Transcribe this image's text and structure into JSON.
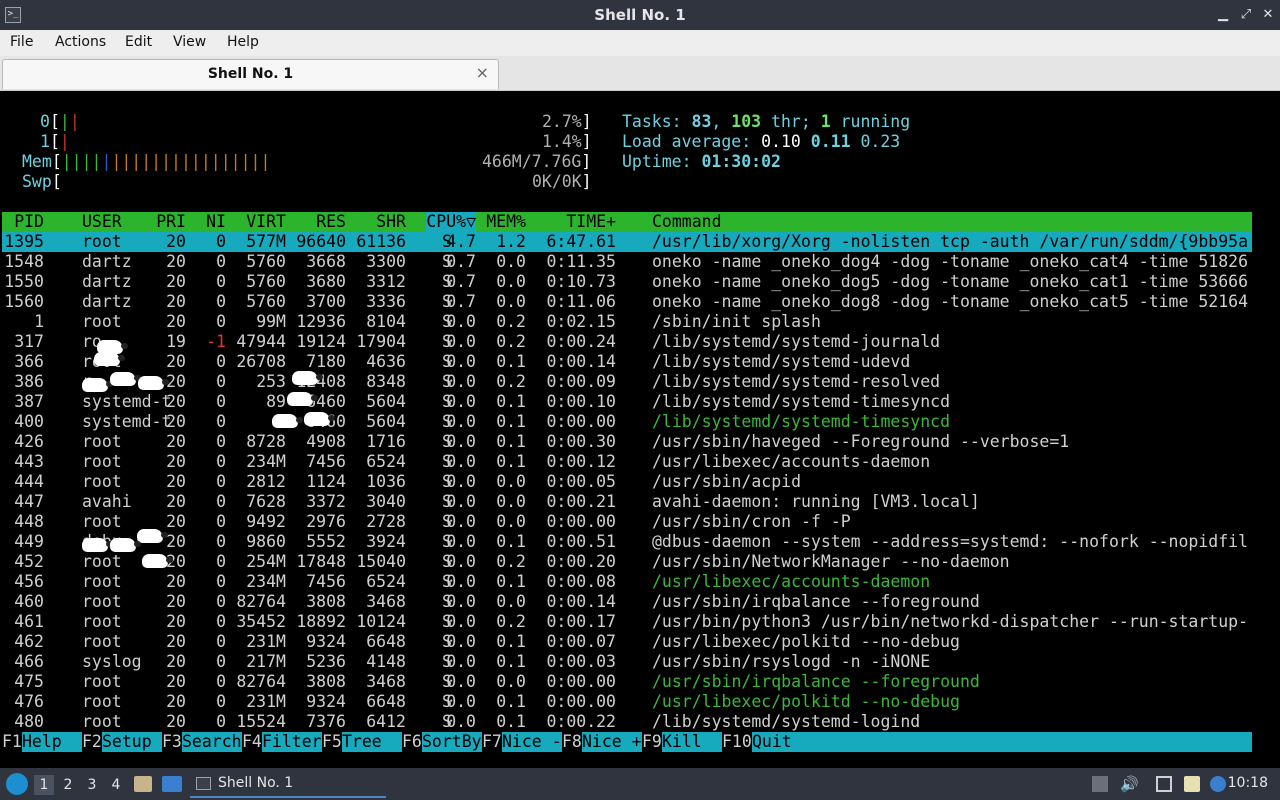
{
  "window": {
    "title": "Shell No. 1"
  },
  "menu": [
    "File",
    "Actions",
    "Edit",
    "View",
    "Help"
  ],
  "tab": {
    "label": "Shell No. 1",
    "close": "×"
  },
  "meters": {
    "cpu0": {
      "label": "0",
      "percent": "2.7%",
      "usage_fraction": 0.027
    },
    "cpu1": {
      "label": "1",
      "percent": "1.4%",
      "usage_fraction": 0.014
    },
    "mem": {
      "label": "Mem",
      "value": "466M/7.76G"
    },
    "swp": {
      "label": "Swp",
      "value": "0K/0K"
    }
  },
  "summary": {
    "tasks_label": "Tasks:",
    "tasks": "83",
    "thr": "103",
    "thr_label": " thr;",
    "running": "1",
    "running_label": "running",
    "load_label": "Load average:",
    "load1": "0.10",
    "load5": "0.11",
    "load15": "0.23",
    "uptime_label": "Uptime:",
    "uptime": "01:30:02"
  },
  "columns": [
    "PID",
    "USER",
    "PRI",
    "NI",
    "VIRT",
    "RES",
    "SHR",
    "S",
    "CPU%▽",
    "MEM%",
    "TIME+",
    "Command"
  ],
  "processes": [
    {
      "pid": "1395",
      "user": "root",
      "pri": "20",
      "ni": "0",
      "virt": "577M",
      "res": "96640",
      "shr": "61136",
      "s": "S",
      "cpu": "4.7",
      "mem": "1.2",
      "time": "6:47.61",
      "cmd": "/usr/lib/xorg/Xorg -nolisten tcp -auth /var/run/sddm/{9bb95a",
      "selected": true
    },
    {
      "pid": "1548",
      "user": "dartz",
      "pri": "20",
      "ni": "0",
      "virt": "5760",
      "res": "3668",
      "shr": "3300",
      "s": "S",
      "cpu": "0.7",
      "mem": "0.0",
      "time": "0:11.35",
      "cmd": "oneko -name _oneko_dog4 -dog -toname _oneko_cat4 -time 51826"
    },
    {
      "pid": "1550",
      "user": "dartz",
      "pri": "20",
      "ni": "0",
      "virt": "5760",
      "res": "3680",
      "shr": "3312",
      "s": "S",
      "cpu": "0.7",
      "mem": "0.0",
      "time": "0:10.73",
      "cmd": "oneko -name _oneko_dog5 -dog -toname _oneko_cat1 -time 53666"
    },
    {
      "pid": "1560",
      "user": "dartz",
      "pri": "20",
      "ni": "0",
      "virt": "5760",
      "res": "3700",
      "shr": "3336",
      "s": "S",
      "cpu": "0.7",
      "mem": "0.0",
      "time": "0:11.06",
      "cmd": "oneko -name _oneko_dog8 -dog -toname _oneko_cat5 -time 52164"
    },
    {
      "pid": "1",
      "user": "root",
      "pri": "20",
      "ni": "0",
      "virt": "99M",
      "res": "12936",
      "shr": "8104",
      "s": "S",
      "cpu": "0.0",
      "mem": "0.2",
      "time": "0:02.15",
      "cmd": "/sbin/init splash"
    },
    {
      "pid": "317",
      "user": "ro",
      "pri": "19",
      "ni": "-1",
      "virt": "47944",
      "res": "19124",
      "shr": "17904",
      "s": "S",
      "cpu": "0.0",
      "mem": "0.2",
      "time": "0:00.24",
      "cmd": "/lib/systemd/systemd-journald",
      "ni_red": true
    },
    {
      "pid": "366",
      "user": "root",
      "pri": "20",
      "ni": "0",
      "virt": "26708",
      "res": "7180",
      "shr": "4636",
      "s": "S",
      "cpu": "0.0",
      "mem": "0.1",
      "time": "0:00.14",
      "cmd": "/lib/systemd/systemd-udevd"
    },
    {
      "pid": "386",
      "user": "r",
      "pri": "20",
      "ni": "0",
      "virt": "253",
      "res": "12408",
      "shr": "8348",
      "s": "S",
      "cpu": "0.0",
      "mem": "0.2",
      "time": "0:00.09",
      "cmd": "/lib/systemd/systemd-resolved"
    },
    {
      "pid": "387",
      "user": "systemd-t",
      "pri": "20",
      "ni": "0",
      "virt": "89",
      "res": "6460",
      "shr": "5604",
      "s": "S",
      "cpu": "0.0",
      "mem": "0.1",
      "time": "0:00.10",
      "cmd": "/lib/systemd/systemd-timesyncd"
    },
    {
      "pid": "400",
      "user": "systemd-t",
      "pri": "20",
      "ni": "0",
      "virt": "8",
      "res": "6460",
      "shr": "5604",
      "s": "S",
      "cpu": "0.0",
      "mem": "0.1",
      "time": "0:00.00",
      "cmd": "/lib/systemd/systemd-timesyncd",
      "thread": true
    },
    {
      "pid": "426",
      "user": "root",
      "pri": "20",
      "ni": "0",
      "virt": "8728",
      "res": "4908",
      "shr": "1716",
      "s": "S",
      "cpu": "0.0",
      "mem": "0.1",
      "time": "0:00.30",
      "cmd": "/usr/sbin/haveged --Foreground --verbose=1"
    },
    {
      "pid": "443",
      "user": "root",
      "pri": "20",
      "ni": "0",
      "virt": "234M",
      "res": "7456",
      "shr": "6524",
      "s": "S",
      "cpu": "0.0",
      "mem": "0.1",
      "time": "0:00.12",
      "cmd": "/usr/libexec/accounts-daemon"
    },
    {
      "pid": "444",
      "user": "root",
      "pri": "20",
      "ni": "0",
      "virt": "2812",
      "res": "1124",
      "shr": "1036",
      "s": "S",
      "cpu": "0.0",
      "mem": "0.0",
      "time": "0:00.05",
      "cmd": "/usr/sbin/acpid"
    },
    {
      "pid": "447",
      "user": "avahi",
      "pri": "20",
      "ni": "0",
      "virt": "7628",
      "res": "3372",
      "shr": "3040",
      "s": "S",
      "cpu": "0.0",
      "mem": "0.0",
      "time": "0:00.21",
      "cmd": "avahi-daemon: running [VM3.local]"
    },
    {
      "pid": "448",
      "user": "root",
      "pri": "20",
      "ni": "0",
      "virt": "9492",
      "res": "2976",
      "shr": "2728",
      "s": "S",
      "cpu": "0.0",
      "mem": "0.0",
      "time": "0:00.00",
      "cmd": "/usr/sbin/cron -f -P"
    },
    {
      "pid": "449",
      "user": "debu",
      "pri": "20",
      "ni": "0",
      "virt": "9860",
      "res": "5552",
      "shr": "3924",
      "s": "S",
      "cpu": "0.0",
      "mem": "0.1",
      "time": "0:00.51",
      "cmd": "@dbus-daemon --system --address=systemd: --nofork --nopidfil"
    },
    {
      "pid": "452",
      "user": "root",
      "pri": "20",
      "ni": "0",
      "virt": "254M",
      "res": "17848",
      "shr": "15040",
      "s": "S",
      "cpu": "0.0",
      "mem": "0.2",
      "time": "0:00.20",
      "cmd": "/usr/sbin/NetworkManager --no-daemon"
    },
    {
      "pid": "456",
      "user": "root",
      "pri": "20",
      "ni": "0",
      "virt": "234M",
      "res": "7456",
      "shr": "6524",
      "s": "S",
      "cpu": "0.0",
      "mem": "0.1",
      "time": "0:00.08",
      "cmd": "/usr/libexec/accounts-daemon",
      "thread": true
    },
    {
      "pid": "460",
      "user": "root",
      "pri": "20",
      "ni": "0",
      "virt": "82764",
      "res": "3808",
      "shr": "3468",
      "s": "S",
      "cpu": "0.0",
      "mem": "0.0",
      "time": "0:00.14",
      "cmd": "/usr/sbin/irqbalance --foreground"
    },
    {
      "pid": "461",
      "user": "root",
      "pri": "20",
      "ni": "0",
      "virt": "35452",
      "res": "18892",
      "shr": "10124",
      "s": "S",
      "cpu": "0.0",
      "mem": "0.2",
      "time": "0:00.17",
      "cmd": "/usr/bin/python3 /usr/bin/networkd-dispatcher --run-startup-"
    },
    {
      "pid": "462",
      "user": "root",
      "pri": "20",
      "ni": "0",
      "virt": "231M",
      "res": "9324",
      "shr": "6648",
      "s": "S",
      "cpu": "0.0",
      "mem": "0.1",
      "time": "0:00.07",
      "cmd": "/usr/libexec/polkitd --no-debug"
    },
    {
      "pid": "466",
      "user": "syslog",
      "pri": "20",
      "ni": "0",
      "virt": "217M",
      "res": "5236",
      "shr": "4148",
      "s": "S",
      "cpu": "0.0",
      "mem": "0.1",
      "time": "0:00.03",
      "cmd": "/usr/sbin/rsyslogd -n -iNONE"
    },
    {
      "pid": "475",
      "user": "root",
      "pri": "20",
      "ni": "0",
      "virt": "82764",
      "res": "3808",
      "shr": "3468",
      "s": "S",
      "cpu": "0.0",
      "mem": "0.0",
      "time": "0:00.00",
      "cmd": "/usr/sbin/irqbalance --foreground",
      "thread": true
    },
    {
      "pid": "476",
      "user": "root",
      "pri": "20",
      "ni": "0",
      "virt": "231M",
      "res": "9324",
      "shr": "6648",
      "s": "S",
      "cpu": "0.0",
      "mem": "0.1",
      "time": "0:00.00",
      "cmd": "/usr/libexec/polkitd --no-debug",
      "thread": true
    },
    {
      "pid": "480",
      "user": "root",
      "pri": "20",
      "ni": "0",
      "virt": "15524",
      "res": "7376",
      "shr": "6412",
      "s": "S",
      "cpu": "0.0",
      "mem": "0.1",
      "time": "0:00.22",
      "cmd": "/lib/systemd/systemd-logind"
    }
  ],
  "function_keys": [
    {
      "key": "F1",
      "label": "Help"
    },
    {
      "key": "F2",
      "label": "Setup"
    },
    {
      "key": "F3",
      "label": "Search"
    },
    {
      "key": "F4",
      "label": "Filter"
    },
    {
      "key": "F5",
      "label": "Tree"
    },
    {
      "key": "F6",
      "label": "SortBy"
    },
    {
      "key": "F7",
      "label": "Nice -"
    },
    {
      "key": "F8",
      "label": "Nice +"
    },
    {
      "key": "F9",
      "label": "Kill"
    },
    {
      "key": "F10",
      "label": "Quit"
    }
  ],
  "taskbar": {
    "workspaces": [
      "1",
      "2",
      "3",
      "4"
    ],
    "task_label": "Shell No. 1",
    "clock": "10:18"
  },
  "colors": {
    "header_bg": "#2cb52c",
    "selection_bg": "#17a9bd",
    "accent": "#6fd0e0",
    "thread_cmd": "#3ab83a"
  }
}
